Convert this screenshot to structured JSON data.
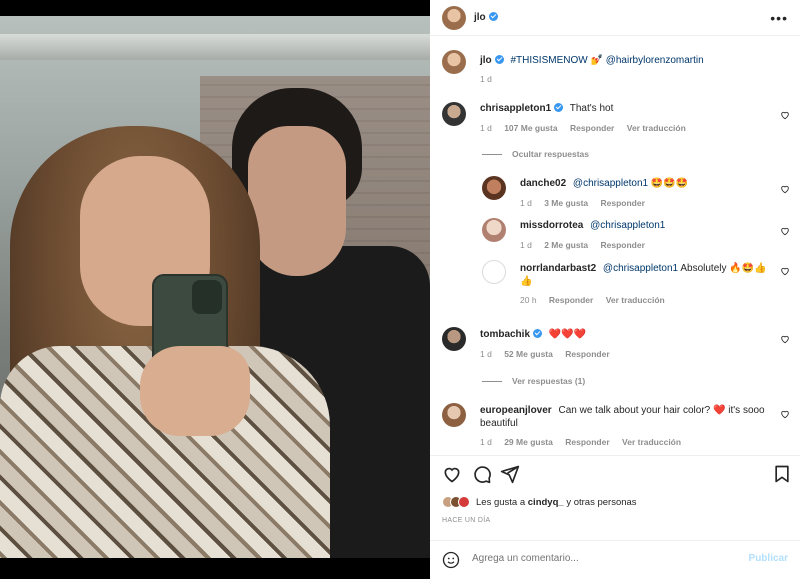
{
  "post": {
    "author": "jlo",
    "caption_user": "jlo",
    "caption_tag": "#THISISMENOW",
    "caption_emoji": "💅",
    "caption_mention": "@hairbylorenzomartin",
    "caption_time": "1 d",
    "likes_prefix": "Les gusta a",
    "likes_user": "cindyq_",
    "likes_suffix": "y otras personas",
    "timestamp": "HACE UN DÍA"
  },
  "comments": [
    {
      "user": "chrisappleton1",
      "verified": true,
      "text": "That's hot",
      "time": "1 d",
      "likes": "107 Me gusta",
      "reply": "Responder",
      "translate": "Ver traducción"
    },
    {
      "user": "danche02",
      "verified": false,
      "mention": "@chrisappleton1",
      "emoji": "🤩🤩🤩",
      "time": "1 d",
      "likes": "3 Me gusta",
      "reply": "Responder"
    },
    {
      "user": "missdorrotea",
      "verified": false,
      "mention": "@chrisappleton1",
      "time": "1 d",
      "likes": "2 Me gusta",
      "reply": "Responder"
    },
    {
      "user": "norrlandarbast2",
      "verified": false,
      "mention": "@chrisappleton1",
      "text": "Absolutely",
      "emoji": "🔥🤩👍",
      "emoji2": "👍",
      "time": "20 h",
      "reply": "Responder",
      "translate": "Ver traducción"
    },
    {
      "user": "tombachik",
      "verified": true,
      "emoji": "❤️❤️❤️",
      "time": "1 d",
      "likes": "52 Me gusta",
      "reply": "Responder"
    },
    {
      "user": "europeanjlover",
      "verified": false,
      "text": "Can we talk about your hair color?",
      "emoji": "❤️",
      "text2": "it's sooo",
      "text3": "beautiful",
      "time": "1 d",
      "likes": "29 Me gusta",
      "reply": "Responder",
      "translate": "Ver traducción"
    }
  ],
  "toggles": {
    "hide_replies": "Ocultar respuestas",
    "view_replies": "Ver respuestas (1)"
  },
  "comment_box": {
    "placeholder": "Agrega un comentario...",
    "publish": "Publicar"
  },
  "icons": {
    "more": "more-options-icon",
    "like": "heart-icon",
    "comment": "comment-icon",
    "share": "share-icon",
    "save": "bookmark-icon",
    "emoji": "emoji-icon"
  },
  "colors": {
    "link": "#00376b",
    "verified": "#3897f0",
    "publish_disabled": "#b2dffc",
    "muted": "#8e8e8e"
  }
}
